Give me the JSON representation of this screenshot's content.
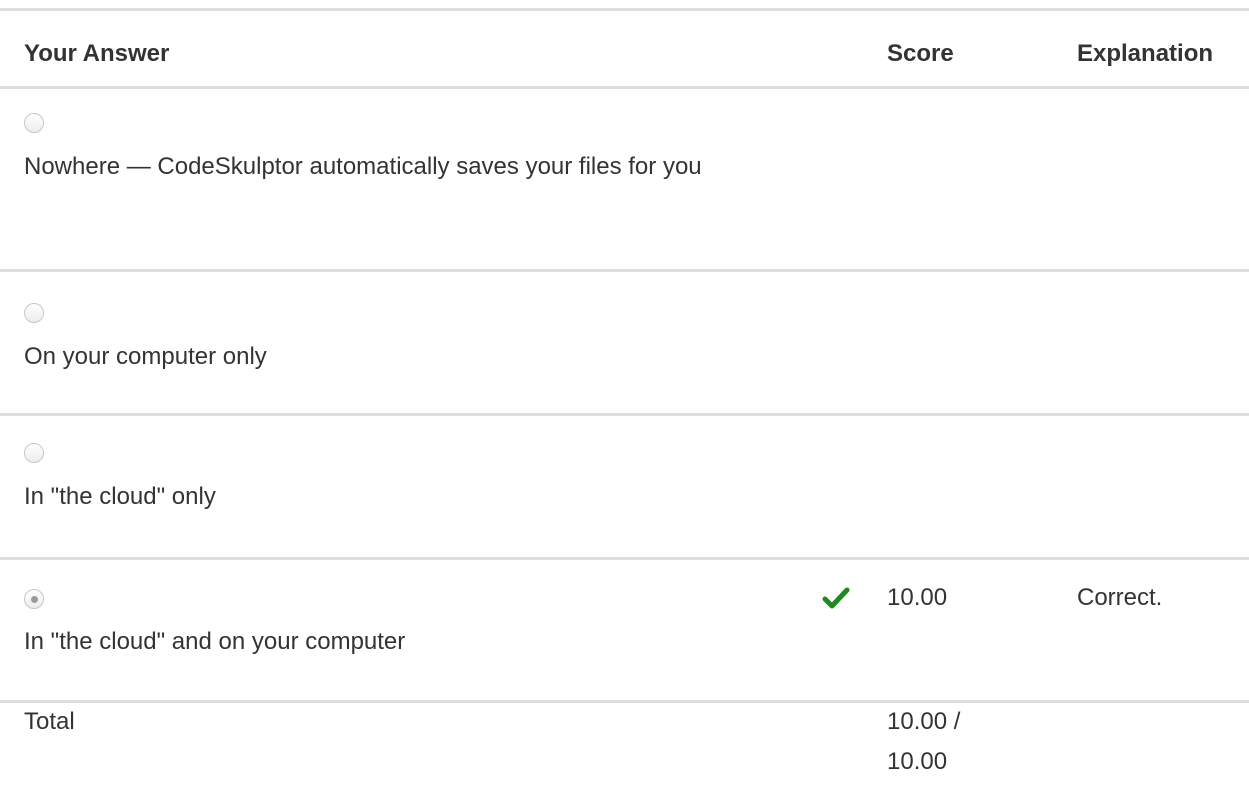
{
  "table": {
    "headers": {
      "answer": "Your Answer",
      "score": "Score",
      "explanation": "Explanation"
    },
    "rows": [
      {
        "text": "Nowhere — CodeSkulptor automatically saves your files for you",
        "selected": false,
        "score": "",
        "explanation": ""
      },
      {
        "text": "On your computer only",
        "selected": false,
        "score": "",
        "explanation": ""
      },
      {
        "text": "In \"the cloud\" only",
        "selected": false,
        "score": "",
        "explanation": ""
      },
      {
        "text": "In \"the cloud\" and on your computer",
        "selected": true,
        "score": "10.00",
        "explanation": "Correct.",
        "status_icon": "checkmark-icon",
        "status_color": "#1e8a1e"
      }
    ],
    "total": {
      "label": "Total",
      "score": "10.00 / 10.00"
    }
  }
}
